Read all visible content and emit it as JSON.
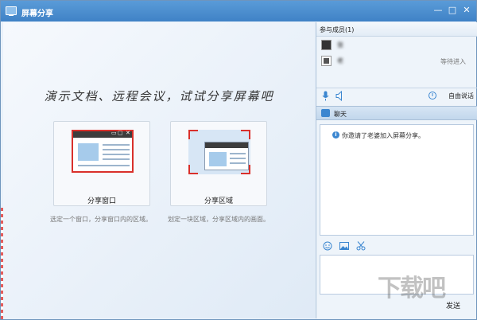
{
  "window": {
    "title": "屏幕分享",
    "min_glyph": "—",
    "max_glyph": "□",
    "close_glyph": "✕"
  },
  "main": {
    "slogan": "演示文档、远程会议，试试分享屏幕吧",
    "share_window": {
      "label": "分享窗口",
      "desc": "选定一个窗口，分享窗口内的区域。"
    },
    "share_area": {
      "label": "分享区域",
      "desc": "划定一块区域，分享区域内的画面。"
    }
  },
  "members": {
    "header": "参与成员(1)",
    "list": [
      {
        "name": "张",
        "status": ""
      },
      {
        "name": "老",
        "status": "等待进入"
      }
    ]
  },
  "voice": {
    "free_talk": "自由说话"
  },
  "chat": {
    "header": "聊天",
    "message": "你邀请了老婆加入屏幕分享。",
    "send_label": "发送"
  },
  "watermark": {
    "text": "下载吧"
  },
  "colors": {
    "accent": "#3f82c6",
    "highlight": "#d9302b"
  }
}
